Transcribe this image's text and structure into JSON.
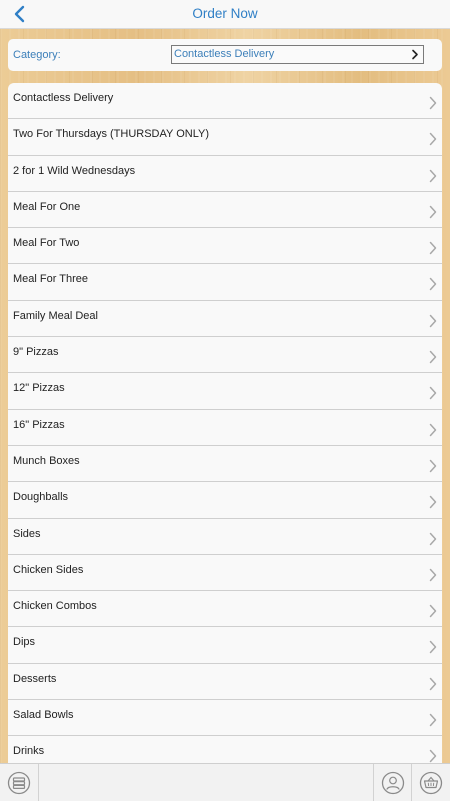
{
  "header": {
    "title": "Order Now",
    "back_icon": "chevron-left-icon"
  },
  "category": {
    "label": "Category:",
    "selected": "Contactless Delivery"
  },
  "menu_items": [
    {
      "label": "Contactless Delivery"
    },
    {
      "label": "Two For Thursdays (THURSDAY ONLY)"
    },
    {
      "label": "2 for 1 Wild Wednesdays"
    },
    {
      "label": "Meal For One"
    },
    {
      "label": "Meal For Two"
    },
    {
      "label": "Meal For Three"
    },
    {
      "label": "Family Meal Deal"
    },
    {
      "label": "9\" Pizzas"
    },
    {
      "label": "12\" Pizzas"
    },
    {
      "label": "16\" Pizzas"
    },
    {
      "label": "Munch Boxes"
    },
    {
      "label": "Doughballs"
    },
    {
      "label": "Sides"
    },
    {
      "label": "Chicken Sides"
    },
    {
      "label": "Chicken Combos"
    },
    {
      "label": "Dips"
    },
    {
      "label": "Desserts"
    },
    {
      "label": "Salad Bowls"
    },
    {
      "label": "Drinks"
    }
  ],
  "toolbar": {
    "left_icon": "menu-list-icon",
    "account_icon": "user-icon",
    "basket_icon": "basket-icon"
  },
  "colors": {
    "accent": "#2f7fc6",
    "chevron": "#a8a8a8"
  }
}
